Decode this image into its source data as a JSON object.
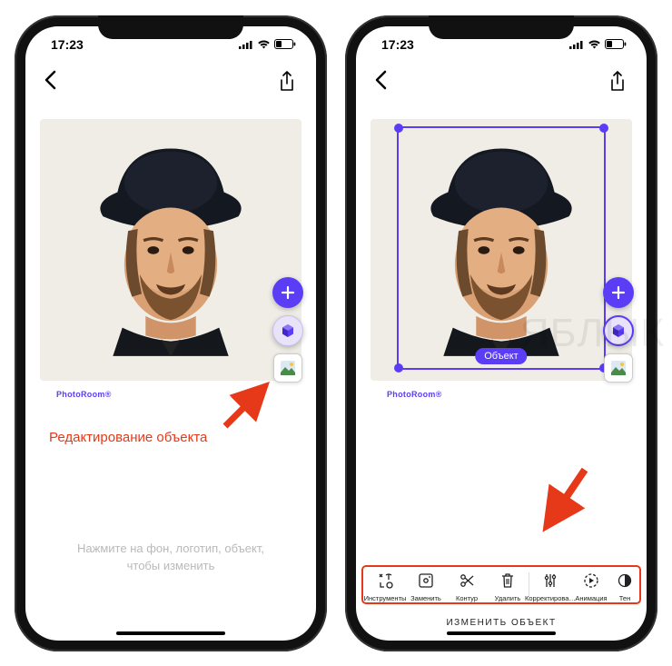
{
  "status": {
    "time": "17:23"
  },
  "brand": "PhotoRoom®",
  "left": {
    "annotation": "Редактирование объекта",
    "hint": "Нажмите на фон, логотип, объект,\nчтобы изменить"
  },
  "right": {
    "object_tag": "Объект",
    "toolbar_title": "ИЗМЕНИТЬ ОБЪЕКТ",
    "tools": {
      "instruments": "Инструменты",
      "replace": "Заменить",
      "outline": "Контур",
      "delete": "Удалить",
      "adjust": "Корректирова…",
      "anim": "Анимация",
      "shadow": "Тен"
    }
  },
  "watermark": "ЯБЛЫК"
}
